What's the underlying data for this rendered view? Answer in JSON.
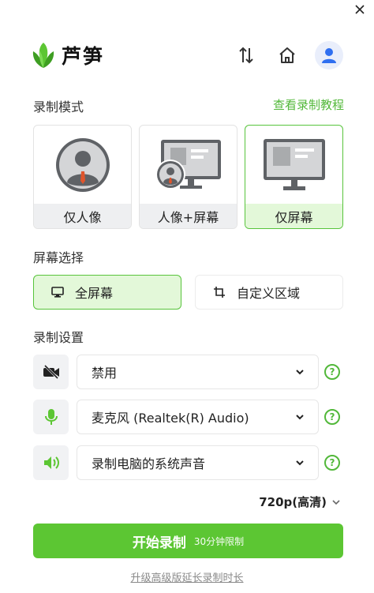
{
  "header": {
    "app_name": "芦笋"
  },
  "recording_mode": {
    "title": "录制模式",
    "tutorial_link": "查看录制教程",
    "modes": [
      {
        "label": "仅人像",
        "active": false
      },
      {
        "label": "人像+屏幕",
        "active": false
      },
      {
        "label": "仅屏幕",
        "active": true
      }
    ]
  },
  "screen_select": {
    "title": "屏幕选择",
    "full_screen": "全屏幕",
    "custom_area": "自定义区域",
    "selected": "全屏幕"
  },
  "settings": {
    "title": "录制设置",
    "camera": "禁用",
    "microphone": "麦克风 (Realtek(R) Audio)",
    "system_audio": "录制电脑的系统声音",
    "help_glyph": "?"
  },
  "quality": "720p(高清)",
  "start": {
    "label": "开始录制",
    "limit": "30分钟限制"
  },
  "upgrade_link": "升级高级版延长录制时长",
  "colors": {
    "accent": "#5cc633",
    "accent_light": "#e3f8d9",
    "icon_gray": "#6f7174"
  },
  "icons": [
    "close-icon",
    "sort-icon",
    "home-icon",
    "user-icon",
    "camera-off-icon",
    "microphone-icon",
    "speaker-icon",
    "monitor-icon",
    "crop-icon",
    "chevron-down-icon",
    "help-icon"
  ]
}
